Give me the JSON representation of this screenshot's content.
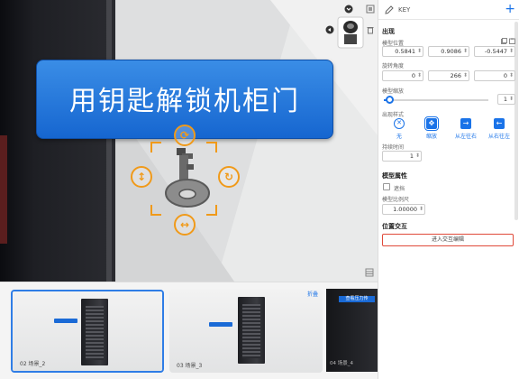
{
  "viewport": {
    "banner_text": "用钥匙解锁机柜门"
  },
  "panel": {
    "header_title": "KEY",
    "section_appear": "出现",
    "position_label": "模型位置",
    "position": [
      "0.5841",
      "0.9086",
      "-0.5447"
    ],
    "rotation_label": "旋转角度",
    "rotation": [
      "0",
      "266",
      "0"
    ],
    "scale_label": "模型缩放",
    "scale_value": "1",
    "scale_fraction": 0.05,
    "appear_style_label": "出现样式",
    "styles": [
      {
        "label": "无",
        "icon": "x-circle-icon"
      },
      {
        "label": "缩放",
        "icon": "scale-icon"
      },
      {
        "label": "从左往右",
        "icon": "arrow-right-icon"
      },
      {
        "label": "从右往左",
        "icon": "arrow-left-icon"
      }
    ],
    "duration_label": "持续时间",
    "duration_value": "1",
    "section_model": "模型属性",
    "occlusion_label": "遮挡",
    "ratio_label": "模型比例尺",
    "ratio_value": "1.00000",
    "section_interact": "位置交互",
    "interact_button": "进入交互编辑"
  },
  "strip": {
    "fold_label": "折叠",
    "scenes": [
      {
        "caption": "02   场景_2",
        "selected": true
      },
      {
        "caption": "03   场景_3",
        "selected": false
      }
    ],
    "partial_tag": "查看压力传",
    "partial_caption": "04   场景_4"
  },
  "colors": {
    "accent": "#1a73e8",
    "banner": "#1666d0",
    "gizmo": "#f09a1a",
    "interact_border": "#e04a3a"
  }
}
